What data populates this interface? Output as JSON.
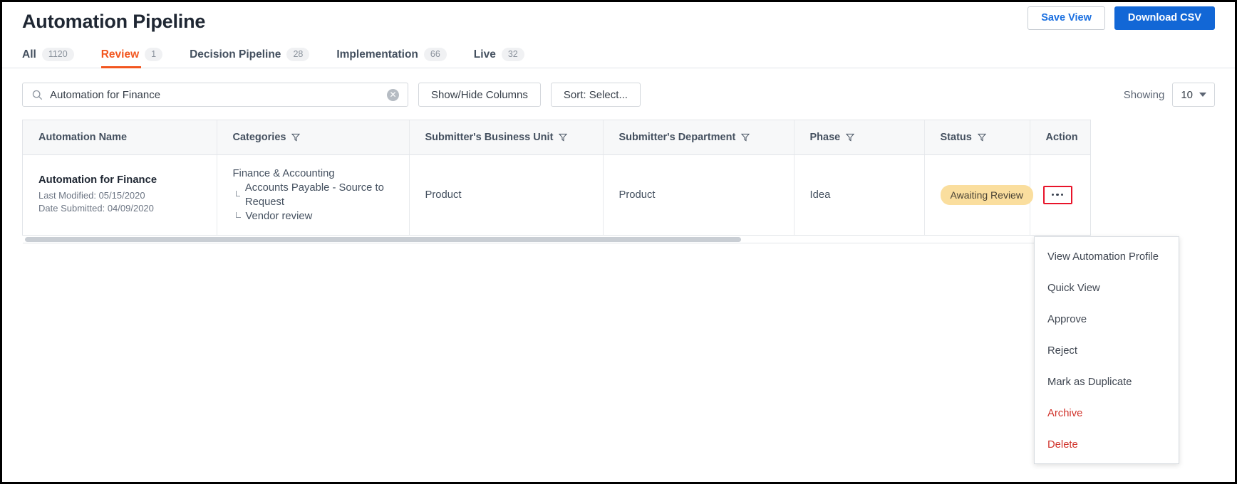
{
  "header": {
    "title": "Automation Pipeline",
    "save_view_label": "Save View",
    "download_csv_label": "Download CSV"
  },
  "tabs": [
    {
      "label": "All",
      "count": "1120",
      "active": false
    },
    {
      "label": "Review",
      "count": "1",
      "active": true
    },
    {
      "label": "Decision Pipeline",
      "count": "28",
      "active": false
    },
    {
      "label": "Implementation",
      "count": "66",
      "active": false
    },
    {
      "label": "Live",
      "count": "32",
      "active": false
    }
  ],
  "toolbar": {
    "search_value": "Automation for Finance",
    "search_placeholder": "Search",
    "search_icon": "search-icon",
    "clear_icon": "clear-icon",
    "clear_glyph": "✕",
    "show_hide_columns_label": "Show/Hide Columns",
    "sort_label": "Sort: Select...",
    "showing_label": "Showing",
    "showing_value": "10"
  },
  "table": {
    "columns": [
      {
        "label": "Automation Name",
        "filterable": false
      },
      {
        "label": "Categories",
        "filterable": true
      },
      {
        "label": "Submitter's Business Unit",
        "filterable": true
      },
      {
        "label": "Submitter's Department",
        "filterable": true
      },
      {
        "label": "Phase",
        "filterable": true
      },
      {
        "label": "Status",
        "filterable": true
      },
      {
        "label": "Action",
        "filterable": false
      }
    ],
    "rows": [
      {
        "name": "Automation for Finance",
        "last_modified": "Last Modified: 05/15/2020",
        "date_submitted": "Date Submitted: 04/09/2020",
        "category_primary": "Finance & Accounting",
        "category_sub_1": "Accounts Payable - Source to Request",
        "category_sub_2": "Vendor review",
        "business_unit": "Product",
        "department": "Product",
        "phase": "Idea",
        "status": "Awaiting Review"
      }
    ]
  },
  "action_menu": {
    "items": [
      {
        "label": "View Automation Profile",
        "danger": false
      },
      {
        "label": "Quick View",
        "danger": false
      },
      {
        "label": "Approve",
        "danger": false
      },
      {
        "label": "Reject",
        "danger": false
      },
      {
        "label": "Mark as Duplicate",
        "danger": false
      },
      {
        "label": "Archive",
        "danger": true
      },
      {
        "label": "Delete",
        "danger": true
      }
    ]
  },
  "colors": {
    "accent_orange": "#f2561f",
    "primary_blue": "#1267d6",
    "status_badge_bg": "#fade9e",
    "danger_red": "#d0342c",
    "highlight_red": "#e8142a"
  }
}
